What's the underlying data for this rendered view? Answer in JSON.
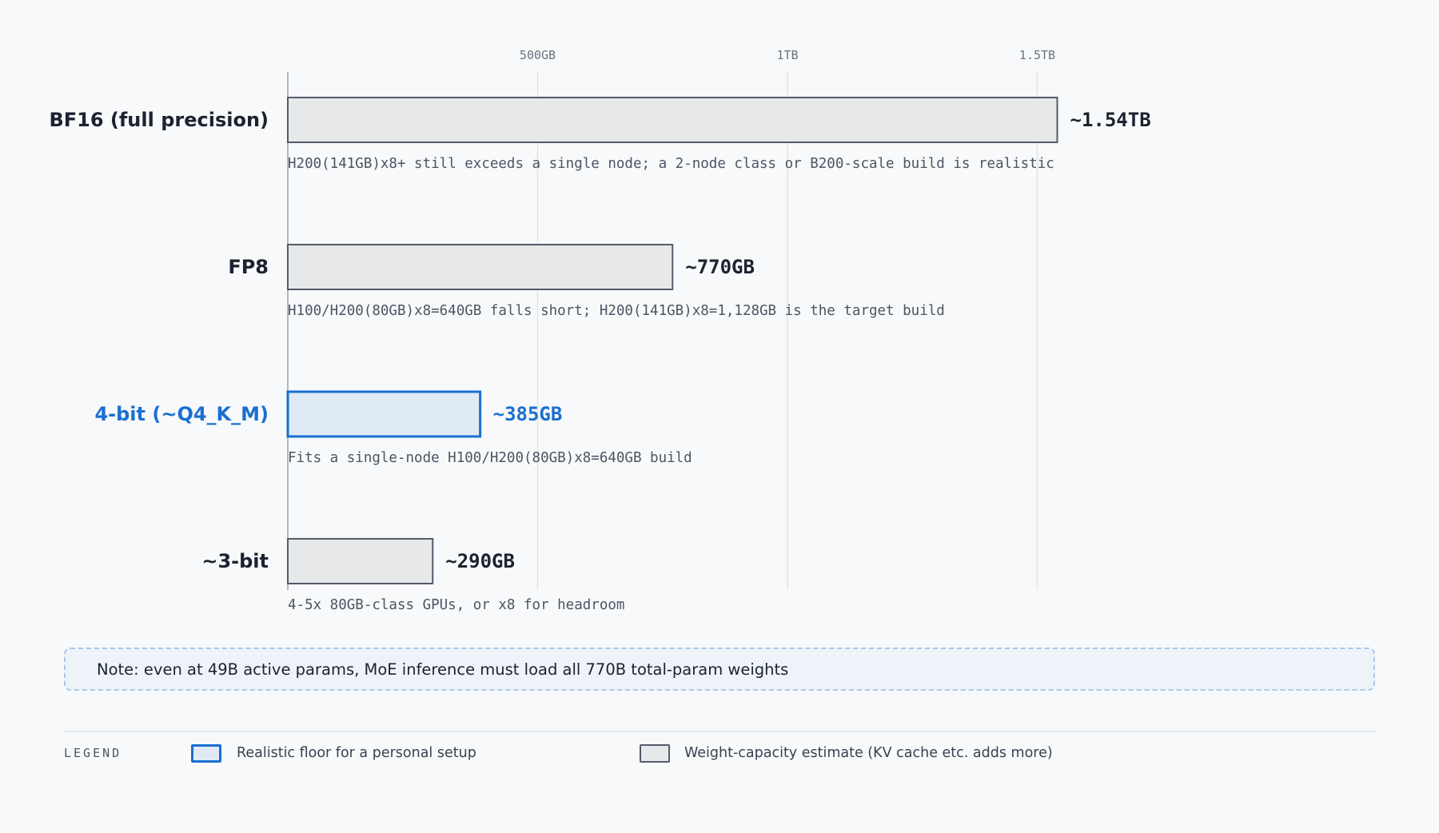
{
  "chart_data": {
    "type": "bar",
    "orientation": "horizontal",
    "unit": "GB",
    "xlim": [
      0,
      1536
    ],
    "ticks": [
      {
        "value": 500,
        "label": "500GB"
      },
      {
        "value": 1000,
        "label": "1TB"
      },
      {
        "value": 1500,
        "label": "1.5TB"
      }
    ],
    "grid": true,
    "categories": [
      "BF16 (full precision)",
      "FP8",
      "4-bit (~Q4_K_M)",
      "~3-bit"
    ],
    "values": [
      1540,
      770,
      385,
      290
    ],
    "value_labels": [
      "~1.54TB",
      "~770GB",
      "~385GB",
      "~290GB"
    ],
    "notes": [
      "H200(141GB)x8+ still exceeds a single node; a 2-node class or B200-scale build is realistic",
      "H100/H200(80GB)x8=640GB falls short; H200(141GB)x8=1,128GB is the target build",
      "Fits a single-node H100/H200(80GB)x8=640GB build",
      "4-5x 80GB-class GPUs, or x8 for headroom"
    ],
    "highlight": [
      false,
      false,
      true,
      false
    ]
  },
  "callout": {
    "text": "Note: even at 49B active params, MoE inference must load all 770B total-param weights"
  },
  "legend": {
    "title": "LEGEND",
    "items": [
      {
        "label": "Realistic floor for a personal setup",
        "style": "highlight"
      },
      {
        "label": "Weight-capacity estimate (KV cache etc. adds more)",
        "style": "estimate"
      }
    ]
  },
  "colors": {
    "highlight_stroke": "#1a6fd1",
    "highlight_fill": "#e0eaf5",
    "estimate_stroke": "#525b69",
    "estimate_fill": "#e7e8ea",
    "text": "#1c2230",
    "grid": "#e1e4e8",
    "axis": "#9aa1ab"
  }
}
